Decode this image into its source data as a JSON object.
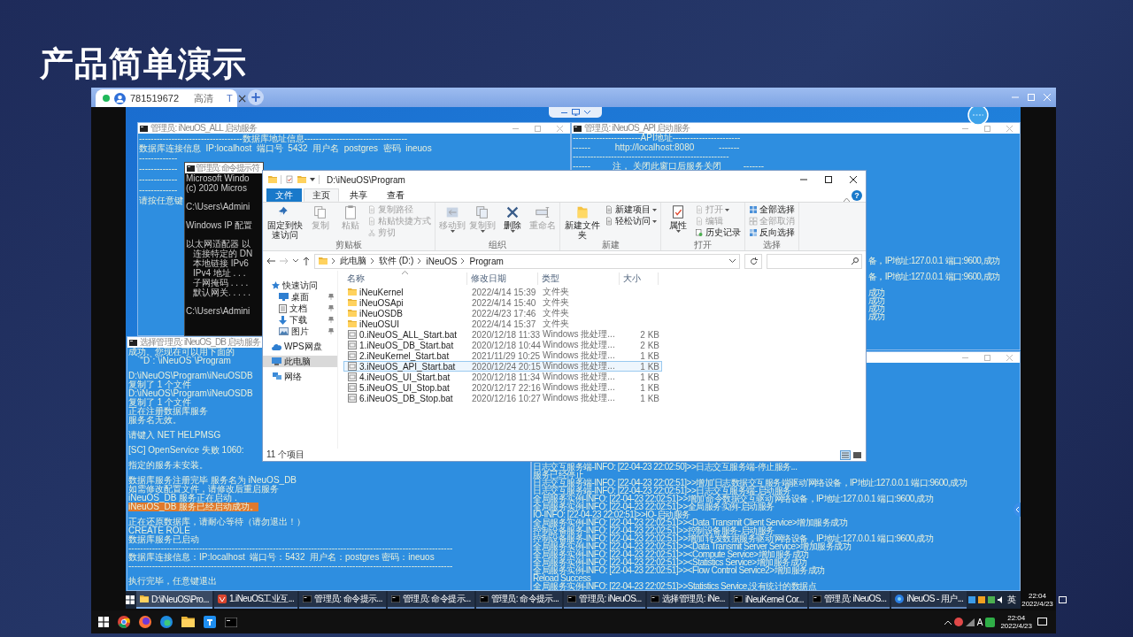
{
  "slide_title": "产品简单演示",
  "viewer": {
    "tab": {
      "name": "781519672",
      "quality": "高清",
      "badge": "T",
      "close": "×"
    },
    "new_tab": "+"
  },
  "console_all": {
    "title": "管理员: iNeuOS_ALL 启动服务",
    "lines": [
      "-----------------------------------数据库地址信息-----------------------------------",
      "数据库连接信息  IP:localhost  端口号  5432  用户名  postgres  密码  ineuos"
    ],
    "side_lines": [
      "-------------",
      "-------------",
      "-------------",
      "-------------",
      "请按任意键"
    ]
  },
  "console_api": {
    "title": "管理员: iNeuOS_API 启动服务",
    "lines": [
      "-----------------------API地址-----------------------",
      "------          http://localhost:8080          -------",
      "-----------------------------------------------------",
      "------         注， 关闭此窗口后服务关闭         -------"
    ],
    "tail_lines": [
      {
        "text": "备，IP地址:127.0.0.1 端口:9600,成功",
        "kind": "block"
      },
      {
        "text": "备，IP地址:127.0.0.1 端口:9600,成功",
        "kind": "block"
      },
      {
        "text": "成功",
        "kind": "block"
      },
      {
        "text": "成功",
        "kind": "line"
      },
      {
        "text": "成功",
        "kind": "line"
      },
      {
        "text": "成功",
        "kind": "line"
      }
    ]
  },
  "cmd": {
    "title": "管理员: 命令提示符",
    "lines": [
      {
        "text": "Microsoft Windo",
        "kind": "line"
      },
      {
        "text": "(c) 2020 Micros",
        "kind": "line"
      },
      {
        "text": "C:\\Users\\Admini",
        "kind": "block"
      },
      {
        "text": "Windows IP 配置",
        "kind": "block"
      },
      {
        "text": "以太网适配器 以",
        "kind": "block"
      },
      {
        "text": "连接特定的 DN",
        "kind": "indented"
      },
      {
        "text": "本地链接 IPv6",
        "kind": "indented"
      },
      {
        "text": "IPv4 地址 . . .",
        "kind": "indented"
      },
      {
        "text": "子网掩码 . . . .",
        "kind": "indented"
      },
      {
        "text": "默认网关. . . . .",
        "kind": "indented"
      },
      {
        "text": "C:\\Users\\Admini",
        "kind": "block"
      }
    ]
  },
  "console_db": {
    "title": "选择管理员: iNeuOS_DB 启动服务",
    "lines": [
      {
        "text": "成功。您现在可以用下面的",
        "kind": "line",
        "selected": false
      },
      {
        "text": "`\"D`:`\\iNeuOS`\\Program",
        "kind": "indented",
        "selected": false
      },
      {
        "text": "D:\\iNeuOS\\Program\\iNeuOSDB",
        "kind": "block",
        "selected": false
      },
      {
        "text": "复制了 1 个文件",
        "kind": "line",
        "selected": false
      },
      {
        "text": "D:\\iNeuOS\\Program\\iNeuOSDB",
        "kind": "line",
        "selected": false
      },
      {
        "text": "复制了 1 个文件",
        "kind": "line",
        "selected": false
      },
      {
        "text": "正在注册数据库服务",
        "kind": "line",
        "selected": false
      },
      {
        "text": "服务名无效。",
        "kind": "line",
        "selected": false
      },
      {
        "text": "请键入 NET HELPMSG",
        "kind": "block",
        "selected": false
      },
      {
        "text": "[SC] OpenService 失败 1060:",
        "kind": "block",
        "selected": false
      },
      {
        "text": "指定的服务未安装。",
        "kind": "block",
        "selected": false
      },
      {
        "text": "数据库服务注册完毕 服务名为 iNeuOS_DB",
        "kind": "block",
        "selected": false
      },
      {
        "text": "如需修改配置文件，请修改后重启服务",
        "kind": "line",
        "selected": false
      },
      {
        "text": "iNeuOS_DB 服务正在启动 .",
        "kind": "line",
        "selected": false
      },
      {
        "text": "iNeuOS_DB 服务已经启动成功。",
        "kind": "line",
        "selected": true
      },
      {
        "text": "正在还原数据库，请耐心等待（请勿退出！）",
        "kind": "block",
        "selected": false
      },
      {
        "text": "CREATE ROLE",
        "kind": "line",
        "selected": false
      },
      {
        "text": "数据库服务已启动",
        "kind": "line",
        "selected": false
      },
      {
        "text": "--------------------------------------------------------------------------------------------------------------",
        "kind": "line",
        "selected": false
      },
      {
        "text": "数据库连接信息：IP:localhost  端口号：5432  用户名：postgres 密码：ineuos",
        "kind": "line",
        "selected": false
      },
      {
        "text": "--------------------------------------------------------------------------------------------------------------",
        "kind": "line",
        "selected": false
      },
      {
        "text": "执行完毕，任意键退出",
        "kind": "block",
        "selected": false
      }
    ]
  },
  "console_log": {
    "lines": [
      "日志交互服务端-INFO: [22-04-23 22:02:50]>>日志交互服务端-停止服务...",
      "服务已经停止",
      "日志交互服务端-INFO: [22-04-23 22:02:51]>>增加'日志数据交互服务端驱动'网络设备，IP地址:127.0.0.1 端口:9600,成功",
      "日志交互服务端-INFO: [22-04-23 22:02:51]>>日志交互服务端-启动服务",
      "全局服务实例-INFO: [22-04-23 22:02:51]>>增加'命令数据交互驱动'网络设备，IP地址:127.0.0.1 端口:9600,成功",
      "全局服务实例-INFO: [22-04-23 22:02:51]>>全局服务实例-启动服务",
      "IO-INFO: [22-04-23 22:02:51]>>IO-启动服务",
      "全局服务实例-INFO: [22-04-23 22:02:51]>><Data Transmit Client Service>增加服务成功",
      "控制设备服务-INFO: [22-04-23 22:02:51]>>控制设备服务-启动服务",
      "控制设备服务-INFO: [22-04-23 22:02:51]>>增加'转发数据服务驱动'网络设备，IP地址:127.0.0.1 端口:9600,成功",
      "全局服务实例-INFO: [22-04-23 22:02:51]>><Data Transmit Server Service>增加服务成功",
      "全局服务实例-INFO: [22-04-23 22:02:51]>><Compute Service>增加服务成功",
      "全局服务实例-INFO: [22-04-23 22:02:51]>><Statistics Service>增加服务成功",
      "全局服务实例-INFO: [22-04-23 22:02:51]>><Flow Control Service2>增加服务成功",
      "Reload Success",
      "全局服务实例-INFO: [22-04-23 22:02:51]>>Statistics Service,没有统计的数据点"
    ]
  },
  "explorer": {
    "title": "D:\\iNeuOS\\Program",
    "help": "?",
    "tabs": [
      {
        "label": "文件",
        "kind": "file",
        "selected": false
      },
      {
        "label": "主页",
        "kind": "tab",
        "selected": true
      },
      {
        "label": "共享",
        "kind": "tab",
        "selected": false
      },
      {
        "label": "查看",
        "kind": "tab",
        "selected": false
      }
    ],
    "ribbon": [
      {
        "label": "剪贴板",
        "items": [
          {
            "label": "固定到快速访问",
            "kind": "large",
            "disabled": false,
            "dropdown": false
          },
          {
            "label": "复制",
            "kind": "large",
            "disabled": true,
            "dropdown": false
          },
          {
            "label": "粘贴",
            "kind": "large",
            "disabled": true,
            "dropdown": false
          },
          {
            "label": "复制路径",
            "kind": "small",
            "disabled": true,
            "dropdown": false
          },
          {
            "label": "粘贴快捷方式",
            "kind": "small",
            "disabled": true,
            "dropdown": false
          },
          {
            "label": "剪切",
            "kind": "small",
            "disabled": true,
            "dropdown": false
          }
        ]
      },
      {
        "label": "组织",
        "items": [
          {
            "label": "移动到",
            "kind": "large",
            "disabled": true,
            "dropdown": true
          },
          {
            "label": "复制到",
            "kind": "large",
            "disabled": true,
            "dropdown": true
          },
          {
            "label": "删除",
            "kind": "large",
            "disabled": false,
            "dropdown": true
          },
          {
            "label": "重命名",
            "kind": "large",
            "disabled": true,
            "dropdown": false
          }
        ]
      },
      {
        "label": "新建",
        "items": [
          {
            "label": "新建文件夹",
            "kind": "large",
            "disabled": false,
            "dropdown": false
          },
          {
            "label": "新建项目",
            "kind": "small",
            "disabled": false,
            "dropdown": true
          },
          {
            "label": "轻松访问",
            "kind": "small",
            "disabled": false,
            "dropdown": true
          }
        ]
      },
      {
        "label": "打开",
        "items": [
          {
            "label": "属性",
            "kind": "large",
            "disabled": false,
            "dropdown": true
          },
          {
            "label": "打开",
            "kind": "small",
            "disabled": true,
            "dropdown": true
          },
          {
            "label": "编辑",
            "kind": "small",
            "disabled": true,
            "dropdown": false
          },
          {
            "label": "历史记录",
            "kind": "small",
            "disabled": false,
            "dropdown": false
          }
        ]
      },
      {
        "label": "选择",
        "items": [
          {
            "label": "全部选择",
            "kind": "small",
            "disabled": false,
            "dropdown": false
          },
          {
            "label": "全部取消",
            "kind": "small",
            "disabled": true,
            "dropdown": false
          },
          {
            "label": "反向选择",
            "kind": "small",
            "disabled": false,
            "dropdown": false
          }
        ]
      }
    ],
    "breadcrumbs": [
      "此电脑",
      "软件 (D:)",
      "iNeuOS",
      "Program"
    ],
    "nav": [
      {
        "label": "快速访问",
        "kind": "star",
        "pinned": false,
        "selected": false
      },
      {
        "label": "桌面",
        "kind": "desktop",
        "pinned": true,
        "selected": false
      },
      {
        "label": "文档",
        "kind": "document",
        "pinned": true,
        "selected": false
      },
      {
        "label": "下载",
        "kind": "download",
        "pinned": true,
        "selected": false
      },
      {
        "label": "图片",
        "kind": "picture",
        "pinned": true,
        "selected": false
      },
      {
        "label": "WPS网盘",
        "kind": "cloud",
        "pinned": false,
        "selected": false
      },
      {
        "label": "此电脑",
        "kind": "computer",
        "pinned": false,
        "selected": true
      },
      {
        "label": "网络",
        "kind": "network",
        "pinned": false,
        "selected": false
      }
    ],
    "columns": [
      "名称",
      "修改日期",
      "类型",
      "大小"
    ],
    "rows": [
      {
        "name": "iNeuKernel",
        "date": "2022/4/14 15:39",
        "type": "文件夹",
        "size": "",
        "kind": "folder",
        "selected": false
      },
      {
        "name": "iNeuOSApi",
        "date": "2022/4/14 15:40",
        "type": "文件夹",
        "kind": "folder",
        "selected": false
      },
      {
        "name": "iNeuOSDB",
        "date": "2022/4/23 17:46",
        "type": "文件夹",
        "kind": "folder",
        "selected": false
      },
      {
        "name": "iNeuOSUI",
        "date": "2022/4/14 15:37",
        "type": "文件夹",
        "kind": "folder",
        "selected": false
      },
      {
        "name": "0.iNeuOS_ALL_Start.bat",
        "date": "2020/12/18 11:33",
        "type": "Windows 批处理...",
        "size": "2 KB",
        "kind": "file",
        "selected": false
      },
      {
        "name": "1.iNeuOS_DB_Start.bat",
        "date": "2020/12/18 10:44",
        "type": "Windows 批处理...",
        "size": "2 KB",
        "kind": "file",
        "selected": false
      },
      {
        "name": "2.iNeuKernel_Start.bat",
        "date": "2021/11/29 10:25",
        "type": "Windows 批处理...",
        "size": "1 KB",
        "kind": "file",
        "selected": false
      },
      {
        "name": "3.iNeuOS_API_Start.bat",
        "date": "2020/12/24 20:15",
        "type": "Windows 批处理...",
        "size": "1 KB",
        "kind": "file",
        "selected": true
      },
      {
        "name": "4.iNeuOS_UI_Start.bat",
        "date": "2020/12/18 11:34",
        "type": "Windows 批处理...",
        "size": "1 KB",
        "kind": "file",
        "selected": false
      },
      {
        "name": "5.iNeuOS_UI_Stop.bat",
        "date": "2020/12/17 22:16",
        "type": "Windows 批处理...",
        "size": "1 KB",
        "kind": "file",
        "selected": false
      },
      {
        "name": "6.iNeuOS_DB_Stop.bat",
        "date": "2020/12/16 10:27",
        "type": "Windows 批处理...",
        "size": "1 KB",
        "kind": "file",
        "selected": false
      }
    ],
    "status": "11 个项目"
  },
  "remote_taskbar": {
    "items": [
      {
        "label": "D:\\iNeuOS\\Pro...",
        "kind": "folder",
        "selected": true
      },
      {
        "label": "1.iNeuOS工业互...",
        "kind": "app",
        "selected": false
      },
      {
        "label": "管理员: 命令提示...",
        "kind": "console",
        "selected": false
      },
      {
        "label": "管理员: 命令提示...",
        "kind": "console",
        "selected": false
      },
      {
        "label": "管理员: 命令提示...",
        "kind": "console",
        "selected": false
      },
      {
        "label": "管理员: iNeuOS...",
        "kind": "console",
        "selected": false
      },
      {
        "label": "选择管理员: iNe...",
        "kind": "console",
        "selected": false
      },
      {
        "label": "iNeuKernel Cor...",
        "kind": "console",
        "selected": false
      },
      {
        "label": "管理员: iNeuOS...",
        "kind": "console",
        "selected": false
      },
      {
        "label": "iNeuOS - 用户...",
        "kind": "browser",
        "selected": false
      }
    ],
    "language": "英",
    "time": "22:04",
    "date": "2022/4/23"
  },
  "host_taskbar": {
    "apps": [
      {
        "kind": "start"
      },
      {
        "kind": "chrome"
      },
      {
        "kind": "firefox"
      },
      {
        "kind": "edge"
      },
      {
        "kind": "folder"
      },
      {
        "kind": "app"
      },
      {
        "kind": "console"
      }
    ],
    "ime": "A",
    "time": "22:04",
    "date": "2022/4/23"
  }
}
